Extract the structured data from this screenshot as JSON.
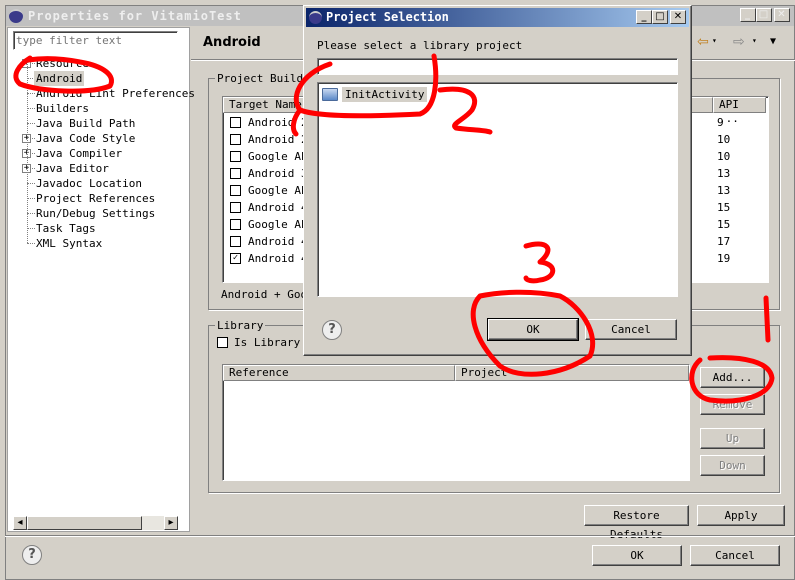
{
  "window": {
    "title": "Properties for VitamioTest",
    "controls": [
      "minimize",
      "maximize",
      "close"
    ]
  },
  "filter": {
    "placeholder": "type filter text",
    "value": ""
  },
  "tree": [
    {
      "label": "Resource",
      "expandable": true
    },
    {
      "label": "Android",
      "selected": true
    },
    {
      "label": "Android Lint Preferences"
    },
    {
      "label": "Builders"
    },
    {
      "label": "Java Build Path"
    },
    {
      "label": "Java Code Style",
      "expandable": true
    },
    {
      "label": "Java Compiler",
      "expandable": true
    },
    {
      "label": "Java Editor",
      "expandable": true
    },
    {
      "label": "Javadoc Location"
    },
    {
      "label": "Project References"
    },
    {
      "label": "Run/Debug Settings"
    },
    {
      "label": "Task Tags"
    },
    {
      "label": "XML Syntax"
    }
  ],
  "page": {
    "title": "Android"
  },
  "build_target": {
    "group_label": "Project Build Target",
    "columns": [
      "Target Name",
      "API ..."
    ],
    "rows": [
      {
        "name": "Android 2",
        "api": "9",
        "checked": false
      },
      {
        "name": "Android 2",
        "api": "10",
        "checked": false
      },
      {
        "name": "Google AP",
        "api": "10",
        "checked": false
      },
      {
        "name": "Android 3",
        "api": "13",
        "checked": false
      },
      {
        "name": "Google AP",
        "api": "13",
        "checked": false
      },
      {
        "name": "Android 4",
        "api": "15",
        "checked": false
      },
      {
        "name": "Google AP",
        "api": "15",
        "checked": false
      },
      {
        "name": "Android 4",
        "api": "17",
        "checked": false
      },
      {
        "name": "Android 4",
        "api": "19",
        "checked": true
      }
    ],
    "footer": "Android + Goog"
  },
  "library": {
    "group_label": "Library",
    "is_library_label": "Is Library",
    "is_library": false,
    "columns": [
      "Reference",
      "Project"
    ],
    "buttons": {
      "add": "Add...",
      "remove": "Remove",
      "up": "Up",
      "down": "Down"
    }
  },
  "page_buttons": {
    "restore": "Restore Defaults",
    "apply": "Apply"
  },
  "dialog_buttons": {
    "ok": "OK",
    "cancel": "Cancel"
  },
  "selection_dialog": {
    "title": "Project Selection",
    "prompt": "Please select a library project",
    "filter_value": "",
    "items": [
      {
        "label": "InitActivity",
        "icon": "project-folder-icon",
        "selected": true
      }
    ],
    "ok": "OK",
    "cancel": "Cancel"
  },
  "annotations": [
    "1",
    "2",
    "3"
  ],
  "annotation_color": "#ff0000"
}
